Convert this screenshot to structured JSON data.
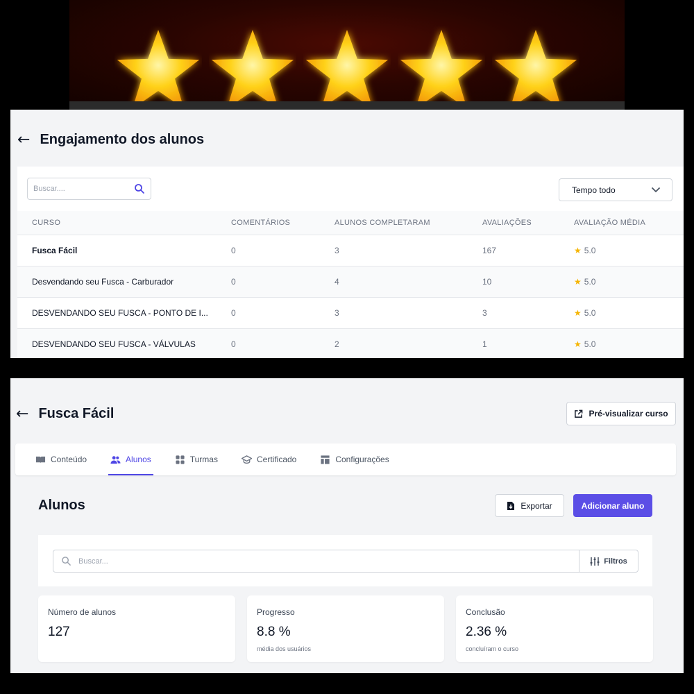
{
  "rating_banner": {
    "stars": 5
  },
  "engagement": {
    "title": "Engajamento dos alunos",
    "search_placeholder": "Buscar....",
    "time_filter": "Tempo todo",
    "columns": [
      "CURSO",
      "COMENTÁRIOS",
      "ALUNOS COMPLETARAM",
      "AVALIAÇÕES",
      "AVALIAÇÃO MÉDIA"
    ],
    "rows": [
      {
        "course": "Fusca Fácil",
        "comments": "0",
        "completed": "3",
        "reviews": "167",
        "rating": "5.0"
      },
      {
        "course": "Desvendando seu Fusca - Carburador",
        "comments": "0",
        "completed": "4",
        "reviews": "10",
        "rating": "5.0"
      },
      {
        "course": "DESVENDANDO SEU FUSCA - PONTO DE I...",
        "comments": "0",
        "completed": "3",
        "reviews": "3",
        "rating": "5.0"
      },
      {
        "course": "DESVENDANDO SEU FUSCA - VÁLVULAS",
        "comments": "0",
        "completed": "2",
        "reviews": "1",
        "rating": "5.0"
      }
    ]
  },
  "course": {
    "title": "Fusca Fácil",
    "preview_label": "Pré-visualizar curso",
    "tabs": [
      {
        "label": "Conteúdo",
        "icon": "book-icon"
      },
      {
        "label": "Alunos",
        "icon": "users-icon"
      },
      {
        "label": "Turmas",
        "icon": "grid-icon"
      },
      {
        "label": "Certificado",
        "icon": "graduation-cap-icon"
      },
      {
        "label": "Configurações",
        "icon": "layout-icon"
      }
    ],
    "active_tab": "Alunos",
    "section_title": "Alunos",
    "export_label": "Exportar",
    "add_label": "Adicionar aluno",
    "search_placeholder": "Buscar...",
    "filters_label": "Filtros",
    "stats": [
      {
        "label": "Número de alunos",
        "value": "127",
        "sub": ""
      },
      {
        "label": "Progresso",
        "value": "8.8 %",
        "sub": "média dos usuários"
      },
      {
        "label": "Conclusão",
        "value": "2.36 %",
        "sub": "concluíram o curso"
      }
    ]
  },
  "colors": {
    "accent": "#5b4ee6",
    "star": "#f5b400",
    "background": "#f3f4f6"
  }
}
